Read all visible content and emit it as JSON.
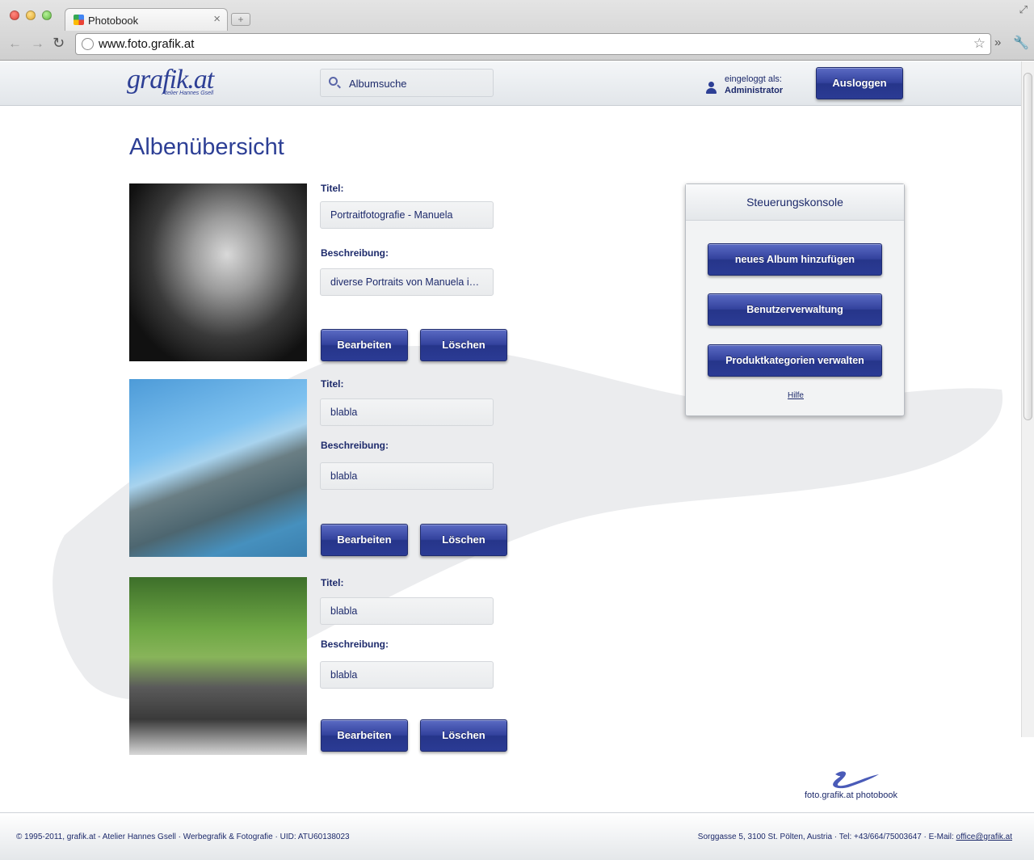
{
  "browser": {
    "tab_title": "Photobook",
    "tab_close": "×",
    "new_tab": "+",
    "url": "www.foto.grafik.at"
  },
  "header": {
    "logo_text": "grafik.at",
    "logo_subtitle": "Atelier Hannes Gsell",
    "search_placeholder": "Albumsuche",
    "login_label": "eingeloggt als:",
    "login_name": "Administrator",
    "logout_label": "Ausloggen"
  },
  "main": {
    "page_title": "Albenübersicht",
    "title_label": "Titel:",
    "description_label": "Beschreibung:",
    "edit_label": "Bearbeiten",
    "delete_label": "Löschen",
    "albums": [
      {
        "title": "Portraitfotografie - Manuela",
        "description": "diverse Portraits von Manuela in s.."
      },
      {
        "title": "blabla",
        "description": "blabla"
      },
      {
        "title": "blabla",
        "description": "blabla"
      }
    ]
  },
  "console": {
    "title": "Steuerungskonsole",
    "buttons": [
      "neues Album hinzufügen",
      "Benutzerverwaltung",
      "Produktkategorien verwalten"
    ],
    "help_label": "Hilfe"
  },
  "footer": {
    "brand_text": "foto.grafik.at photobook",
    "left_text": "© 1995-2011, grafik.at - Atelier Hannes Gsell · Werbegrafik & Fotografie · UID: ATU60138023",
    "right_text": "Sorggasse 5, 3100 St. Pölten, Austria · Tel: +43/664/75003647 · E-Mail: ",
    "email": "office@grafik.at"
  },
  "colors": {
    "accent": "#2d3f95",
    "text": "#1d2a6b"
  }
}
